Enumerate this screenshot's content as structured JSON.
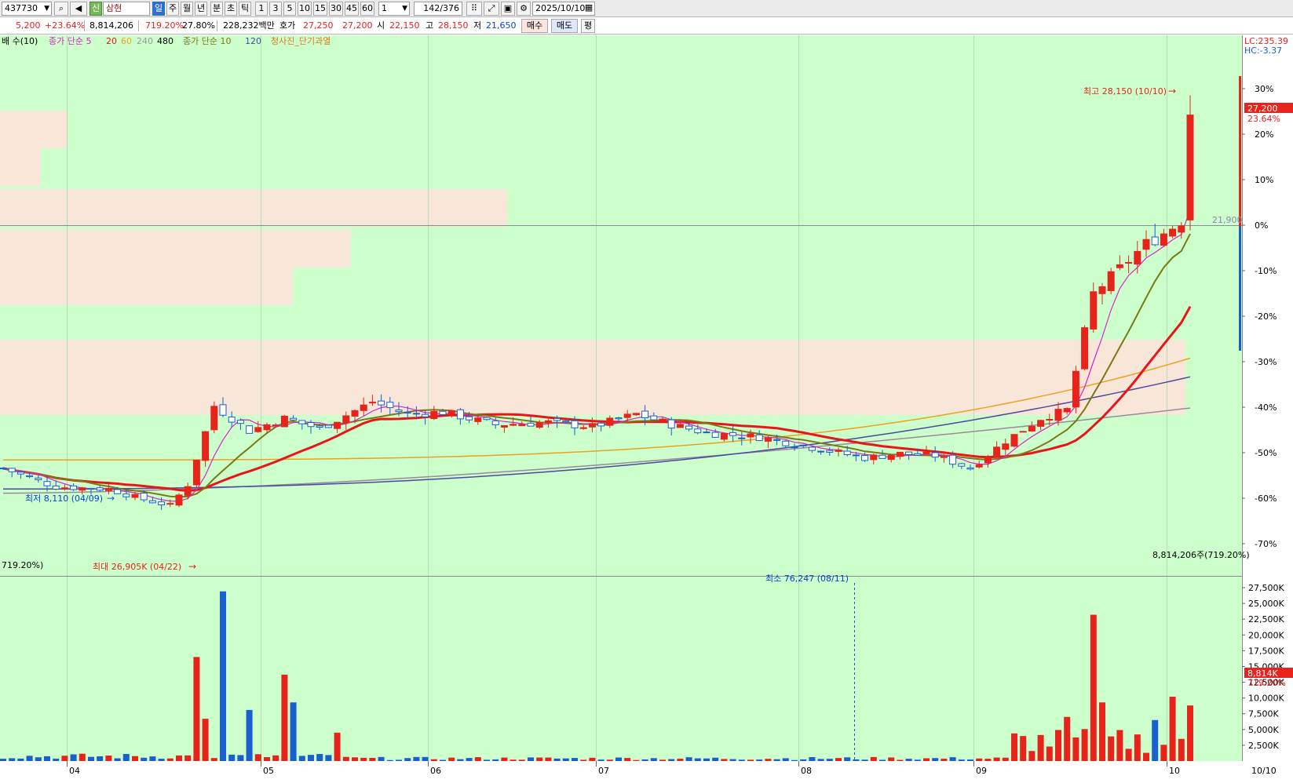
{
  "toolbar": {
    "stock_code": "437730",
    "market_badge": "신",
    "stock_name": "삼현",
    "period_buttons": [
      "일",
      "주",
      "월",
      "년",
      "분",
      "초",
      "틱"
    ],
    "interval_buttons": [
      "1",
      "3",
      "5",
      "10",
      "15",
      "30",
      "45",
      "60"
    ],
    "interval_value": "1",
    "page_counter": "142",
    "page_total": "/376",
    "date": "2025/10/10"
  },
  "quote": {
    "change": "5,200",
    "change_rate": "+23.64%",
    "volume": "8,814,206",
    "volume_ratio": "719.20%",
    "turnover": "27.80%",
    "amount": "228,232백만",
    "bid_label": "호가",
    "bid": "27,250",
    "ask": "27,200",
    "open_label": "시",
    "open": "22,150",
    "high_label": "고",
    "high": "28,150",
    "low_label": "저",
    "low": "21,650",
    "buy_button": "매수",
    "sell_button": "매도",
    "avg_button": "평"
  },
  "legend": {
    "volume_item": "배 수(10)",
    "ma1_label": "종가 단순 5",
    "ma1_values": [
      "20",
      "60",
      "240",
      "480"
    ],
    "ma2_label": "종가 단순 10",
    "ma2_value": "120",
    "signal_label": "청사진_단기과열"
  },
  "right_labels": {
    "lc": "LC:235.39",
    "hc": "HC:-3.37",
    "price_tag": "27,200",
    "rate_tag": "23.64%",
    "base_price": "21,900",
    "volume_header": "8,814,206주(719.20%)",
    "volume_tag": "8,814K",
    "volume_tag_rate": "719.20%",
    "date_label": "10/10"
  },
  "annotations": {
    "price_high": "최고 28,150 (10/10)",
    "price_low": "최저 8,110 (04/09)",
    "vol_max": "최대 26,905K (04/22)",
    "vol_min": "최소 76,247 (08/11)",
    "vol_left": "719.20%)"
  },
  "colors": {
    "background": "#ccffcc",
    "up": "#e8231c",
    "down": "#1a5fd0",
    "ma5": "#dd22cc",
    "ma10": "#7a7a12",
    "ma20": "#e8161b",
    "ma60": "#f0a020",
    "ma240": "#4a4aa0",
    "ma480": "#9a8a9a",
    "supply_zone": "#f8e6d8"
  },
  "chart_data": {
    "type": "candlestick",
    "price_axis_pct": [
      "30%",
      "20%",
      "10%",
      "0%",
      "-10%",
      "-20%",
      "-30%",
      "-40%",
      "-50%",
      "-60%",
      "-70%"
    ],
    "volume_axis": [
      "27,500K",
      "25,000K",
      "22,500K",
      "20,000K",
      "17,500K",
      "15,000K",
      "12,500K",
      "10,000K",
      "7,500K",
      "5,000K",
      "2,500K"
    ],
    "months": [
      "04",
      "05",
      "06",
      "07",
      "08",
      "09",
      "10"
    ],
    "base_price": 21900,
    "high": 28150,
    "low": 8110,
    "last_close": 27200,
    "volume_max_k": 26905,
    "last_volume_k": 8814
  }
}
